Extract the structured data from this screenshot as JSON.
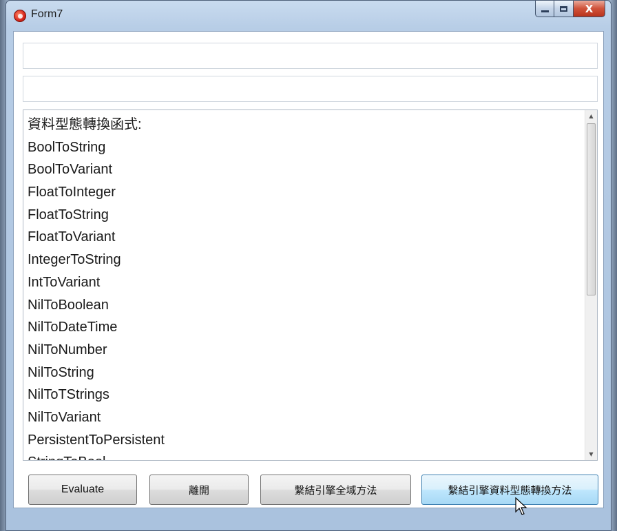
{
  "window": {
    "title": "Form7",
    "close_glyph": "X",
    "icons": {
      "app": "app-icon",
      "minimize": "minimize-icon",
      "maximize": "maximize-icon",
      "close": "close-icon"
    }
  },
  "inputs": {
    "top_value": "",
    "second_value": ""
  },
  "list": {
    "items": [
      "資料型態轉換函式:",
      "BoolToString",
      "BoolToVariant",
      "FloatToInteger",
      "FloatToString",
      "FloatToVariant",
      "IntegerToString",
      "IntToVariant",
      "NilToBoolean",
      "NilToDateTime",
      "NilToNumber",
      "NilToString",
      "NilToTStrings",
      "NilToVariant",
      "PersistentToPersistent",
      "StringToBool"
    ],
    "scroll_up_glyph": "▲",
    "scroll_down_glyph": "▼"
  },
  "buttons": {
    "evaluate": "Evaluate",
    "exit": "離開",
    "bind_global": "繫結引擎全域方法",
    "bind_convert": "繫結引擎資料型態轉換方法"
  },
  "colors": {
    "title_bar": "#c9dbef",
    "close_button": "#d0523a",
    "hover_button": "#bee6fd"
  }
}
